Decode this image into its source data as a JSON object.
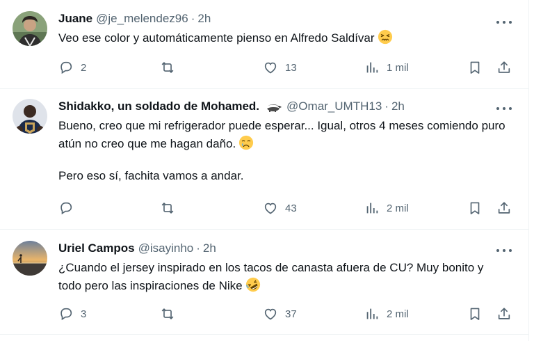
{
  "tweets": [
    {
      "name": "Juane",
      "handle": "@je_melendez96",
      "time": "2h",
      "text": "Veo ese color y automáticamente pienso en Alfredo Saldívar",
      "emoji": "persevering-face",
      "replies": "2",
      "retweets": "",
      "likes": "13",
      "views": "1 mil",
      "avatar_colors": [
        "#6f8a5c",
        "#d9c9b4"
      ]
    },
    {
      "name": "Shidakko, un soldado de Mohamed.",
      "badge": "badger-icon",
      "handle": "@Omar_UMTH13",
      "time": "2h",
      "text": "Bueno, creo que mi refrigerador puede esperar... Igual, otros 4 meses comiendo puro atún no creo que me hagan daño.",
      "emoji": "crying-face",
      "text2": "Pero eso sí, fachita vamos a andar.",
      "replies": "",
      "retweets": "",
      "likes": "43",
      "views": "2 mil",
      "avatar_colors": [
        "#1b2a4a",
        "#c9a35a"
      ]
    },
    {
      "name": "Uriel Campos",
      "handle": "@isayinho",
      "time": "2h",
      "text": "¿Cuando el jersey inspirado en los tacos de canasta afuera de CU? Muy bonito y todo pero las inspiraciones de Nike",
      "emoji": "rolling-on-floor-laughing",
      "replies": "3",
      "retweets": "",
      "likes": "37",
      "views": "2 mil",
      "avatar_colors": [
        "#e9b56a",
        "#5a6f8a"
      ]
    }
  ],
  "colors": {
    "text": "#0f1419",
    "secondary": "#536471",
    "border": "#eff3f4"
  }
}
